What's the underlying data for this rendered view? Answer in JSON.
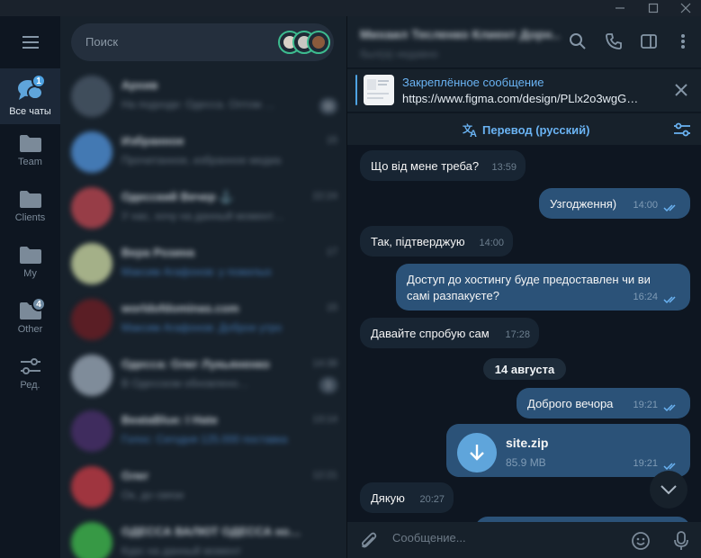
{
  "window": {
    "controls": [
      "minimize",
      "maximize",
      "close"
    ]
  },
  "rail": {
    "menu_icon": "hamburger-icon",
    "folders": [
      {
        "label": "Все чаты",
        "badge": "1",
        "icon": "chat-bubbles-icon",
        "active": true
      },
      {
        "label": "Team",
        "badge": "",
        "icon": "folder-icon",
        "active": false
      },
      {
        "label": "Clients",
        "badge": "",
        "icon": "folder-icon",
        "active": false
      },
      {
        "label": "My",
        "badge": "",
        "icon": "folder-icon",
        "active": false
      },
      {
        "label": "Other",
        "badge": "4",
        "icon": "folder-icon",
        "active": false
      },
      {
        "label": "Ред.",
        "badge": "",
        "icon": "sliders-icon",
        "active": false
      }
    ]
  },
  "chatlist": {
    "search_placeholder": "Поиск",
    "items": [
      {
        "name": "Архив",
        "message": "На подходе: Одесса. Оптом …",
        "time": "",
        "count": "11"
      },
      {
        "name": "Избранное",
        "message": "Прочитанное, избранное медиа",
        "time": "15",
        "count": ""
      },
      {
        "name": "Одесский Вечер ⚓",
        "message": "У нас, хочу на данный момент…",
        "time": "22:24",
        "count": ""
      },
      {
        "name": "Вера Розина",
        "message": "Максим Агафонов: у пожилых",
        "time": "17",
        "count": ""
      },
      {
        "name": "worldofdominas.com",
        "message": "Максим Агафонов: Доброе утро",
        "time": "15",
        "count": ""
      },
      {
        "name": "Одесса: Олег Лукьяненко",
        "message": "В Одесском обновлено…",
        "time": "14:38",
        "count": "1"
      },
      {
        "name": "BeataBlue: I Hate",
        "message": "Голос: Сегодня 125.000 поставка",
        "time": "13:14",
        "count": ""
      },
      {
        "name": "Олег",
        "message": "Ок, до связи",
        "time": "12:21",
        "count": ""
      },
      {
        "name": "ОДЕССА ВАЛЮТ ОДЕССА но…",
        "message": "Курс на данный момент",
        "time": "",
        "count": ""
      }
    ]
  },
  "header": {
    "peer_title": "Михаил Тесленко Клиент Дорн…",
    "peer_status": "был(а) недавно",
    "icons": [
      "search-icon",
      "phone-icon",
      "sidebar-toggle-icon",
      "more-icon"
    ]
  },
  "pinned": {
    "title": "Закреплённое сообщение",
    "text": "https://www.figma.com/design/PLlx2o3wgG…"
  },
  "translate": {
    "label": "Перевод (русский)"
  },
  "messages": [
    {
      "dir": "in",
      "text": "Що від мене треба?",
      "time": "13:59"
    },
    {
      "dir": "out",
      "text": "Узгодження)",
      "time": "14:00"
    },
    {
      "dir": "in",
      "text": "Так, підтверджую",
      "time": "14:00"
    },
    {
      "dir": "out",
      "text": "Доступ до хостингу буде предоставлен чи ви самі разпакуєте?",
      "time": "16:24"
    },
    {
      "dir": "in",
      "text": "Давайте спробую сам",
      "time": "17:28"
    },
    {
      "dir": "out",
      "text": "Доброго вечора",
      "time": "19:21"
    },
    {
      "dir": "out",
      "type": "file",
      "file_name": "site.zip",
      "file_size": "85.9 MB",
      "time": "19:21"
    },
    {
      "dir": "in",
      "text": "Дякую",
      "time": "20:27"
    }
  ],
  "date_separator": "14 августа",
  "composer": {
    "placeholder": "Сообщение..."
  },
  "colors": {
    "accent": "#6ab3f3",
    "outgoing_bubble": "#2b5278",
    "incoming_bubble": "#182533",
    "background": "#0e1621"
  }
}
